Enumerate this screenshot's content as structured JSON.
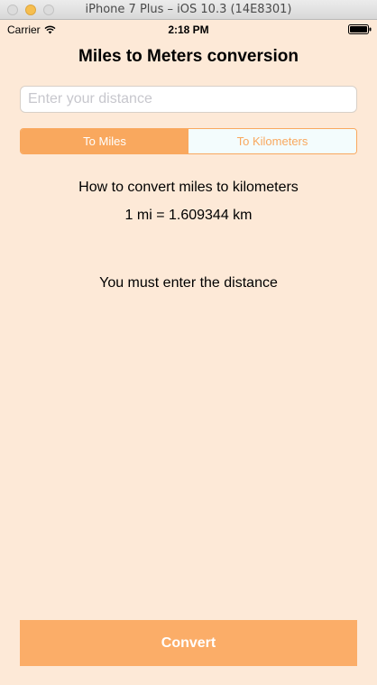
{
  "window": {
    "title": "iPhone 7 Plus – iOS 10.3 (14E8301)"
  },
  "status_bar": {
    "carrier": "Carrier",
    "time": "2:18 PM",
    "wifi_icon": "wifi-icon",
    "battery_icon": "battery-icon"
  },
  "nav": {
    "title": "Miles to Meters conversion"
  },
  "distance_input": {
    "placeholder": "Enter your distance",
    "value": ""
  },
  "segmented": {
    "options": [
      "To Miles",
      "To Kilometers"
    ],
    "selected": "To Miles"
  },
  "info": {
    "heading": "How to convert miles to kilometers",
    "formula": "1 mi = 1.609344 km",
    "message": "You must enter the distance"
  },
  "convert_button": {
    "label": "Convert"
  },
  "colors": {
    "background": "#fde9d7",
    "accent": "#f9a85e",
    "button": "#fbad68",
    "segment_unselected_bg": "#f3fcfd"
  }
}
